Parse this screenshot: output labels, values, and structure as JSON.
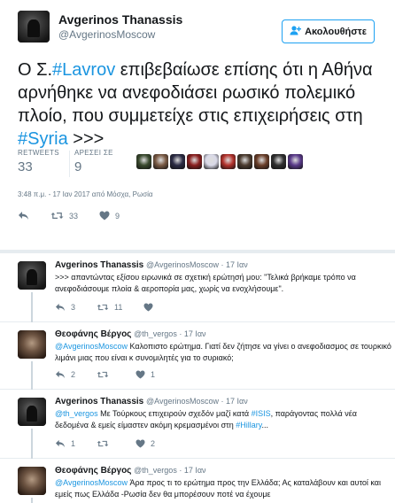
{
  "main_tweet": {
    "author_name": "Avgerinos Thanassis",
    "author_handle": "@AvgerinosMoscow",
    "follow_label": "Ακολουθήστε",
    "text_parts": {
      "p1": "Ο Σ.",
      "tag1": "#Lavrov",
      "p2": " επιβεβαίωσε επίσης ότι η Αθήνα αρνήθηκε να ανεφοδιάσει ρωσικό πολεμικό πλοίο, που συμμετείχε στις επιχειρήσεις στη ",
      "tag2": "#Syria",
      "p3": " >>>"
    },
    "retweets_label": "RETWEETS",
    "retweets_count": "33",
    "likes_label": "ΑΡΕΣΕΙ ΣΕ",
    "likes_count": "9",
    "timestamp": "3:48 π.μ. - 17 Ιαν 2017 από Μόσχα, Ρωσία",
    "action_retweets": "33",
    "action_likes": "9"
  },
  "likers": [
    {
      "color": "#3a4a2e"
    },
    {
      "color": "#7a5a44"
    },
    {
      "color": "#2b2b44"
    },
    {
      "color": "#8a1f1f"
    },
    {
      "color": "#d9d9e8"
    },
    {
      "color": "#b3322c"
    },
    {
      "color": "#4c3c30"
    },
    {
      "color": "#6b3f2a"
    },
    {
      "color": "#2f2f2f"
    },
    {
      "color": "#5a3a8a"
    }
  ],
  "replies": [
    {
      "name": "Avgerinos Thanassis",
      "meta": "@AvgerinosMoscow · 17 Ιαν",
      "text": ">>> απαντώντας εξίσου ειρωνικά σε σχετική ερώτησή μου: \"Τελικά βρήκαμε τρόπο να ανεφοδιάσουμε πλοία & αεροπορία μας, χωρίς να ενοχλήσουμε\".",
      "replies": "3",
      "retweets": "11",
      "likes": ""
    },
    {
      "name": "Θεοφάνης Βέργος",
      "meta": "@th_vergos · 17 Ιαν",
      "mention": "@AvgerinosMoscow",
      "text": " Καλοπιστο ερώτημα. Γιατί δεν ζήτησε να γίνει ο ανεφοδιασμος σε τουρκικό λιμάνι μιας που είναι κ συνομιλητές για το συριακό;",
      "replies": "2",
      "retweets": "",
      "likes": "1"
    },
    {
      "name": "Avgerinos Thanassis",
      "meta": "@AvgerinosMoscow · 17 Ιαν",
      "mention": "@th_vergos",
      "text_a": " Με Τούρκους επιχειρούν σχεδόν μαζί κατά ",
      "tag_a": "#ISIS",
      "text_b": ", παράγοντας πολλά νέα δεδομένα & εμείς είμαστεν ακόμη κρεμασμένοι στη ",
      "tag_b": "#Hillary",
      "text_c": "...",
      "replies": "1",
      "retweets": "",
      "likes": "2"
    },
    {
      "name": "Θεοφάνης Βέργος",
      "meta": "@th_vergos · 17 Ιαν",
      "mention": "@AvgerinosMoscow",
      "text": " Άρα προς τι το ερώτημα προς την Ελλάδα; Ας καταλάβουν και αυτοί και εμείς πως Ελλάδα -Ρωσία δεν θα μπορέσουν ποτέ να έχουμε"
    }
  ]
}
